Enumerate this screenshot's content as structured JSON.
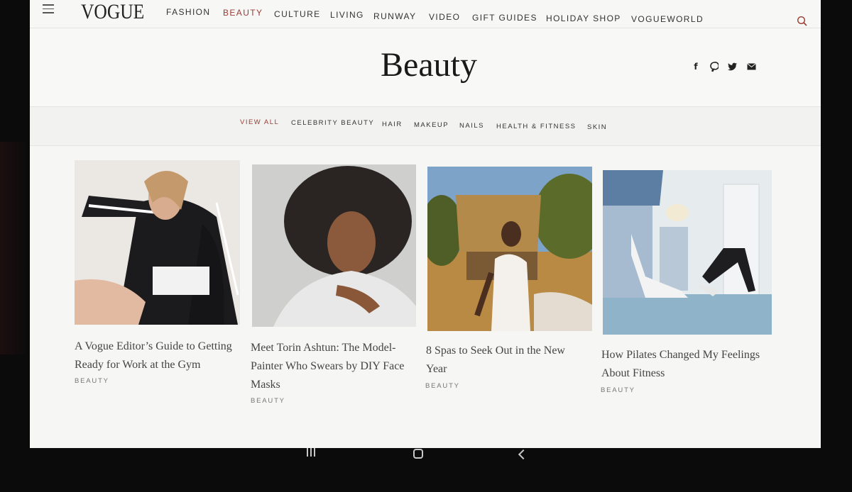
{
  "header": {
    "logo": "VOGUE",
    "nav": [
      "FASHION",
      "BEAUTY",
      "CULTURE",
      "LIVING",
      "RUNWAY",
      "VIDEO",
      "GIFT GUIDES",
      "HOLIDAY SHOP",
      "VOGUEWORLD"
    ],
    "active_nav": "BEAUTY"
  },
  "section": {
    "title": "Beauty",
    "social_icons": [
      "facebook-icon",
      "pinterest-icon",
      "twitter-icon",
      "email-icon"
    ]
  },
  "subnav": {
    "items": [
      "VIEW ALL",
      "CELEBRITY BEAUTY",
      "HAIR",
      "MAKEUP",
      "NAILS",
      "HEALTH & FITNESS",
      "SKIN"
    ],
    "active": "VIEW ALL"
  },
  "articles": [
    {
      "headline_lines": [
        "A Vogue Editor’s Guide to Getting",
        "Ready for Work at the Gym"
      ],
      "tag": "BEAUTY"
    },
    {
      "headline_lines": [
        "Meet Torin Ashtun: The Model-",
        "Painter Who Swears by DIY Face",
        "Masks"
      ],
      "tag": "BEAUTY"
    },
    {
      "headline_lines": [
        "8 Spas to Seek Out in the New",
        "Year"
      ],
      "tag": "BEAUTY"
    },
    {
      "headline_lines": [
        "How Pilates Changed My Feelings",
        "About Fitness"
      ],
      "tag": "BEAUTY"
    }
  ],
  "colors": {
    "accent": "#9b3b33",
    "text": "#333333",
    "background": "#f6f6f5"
  }
}
